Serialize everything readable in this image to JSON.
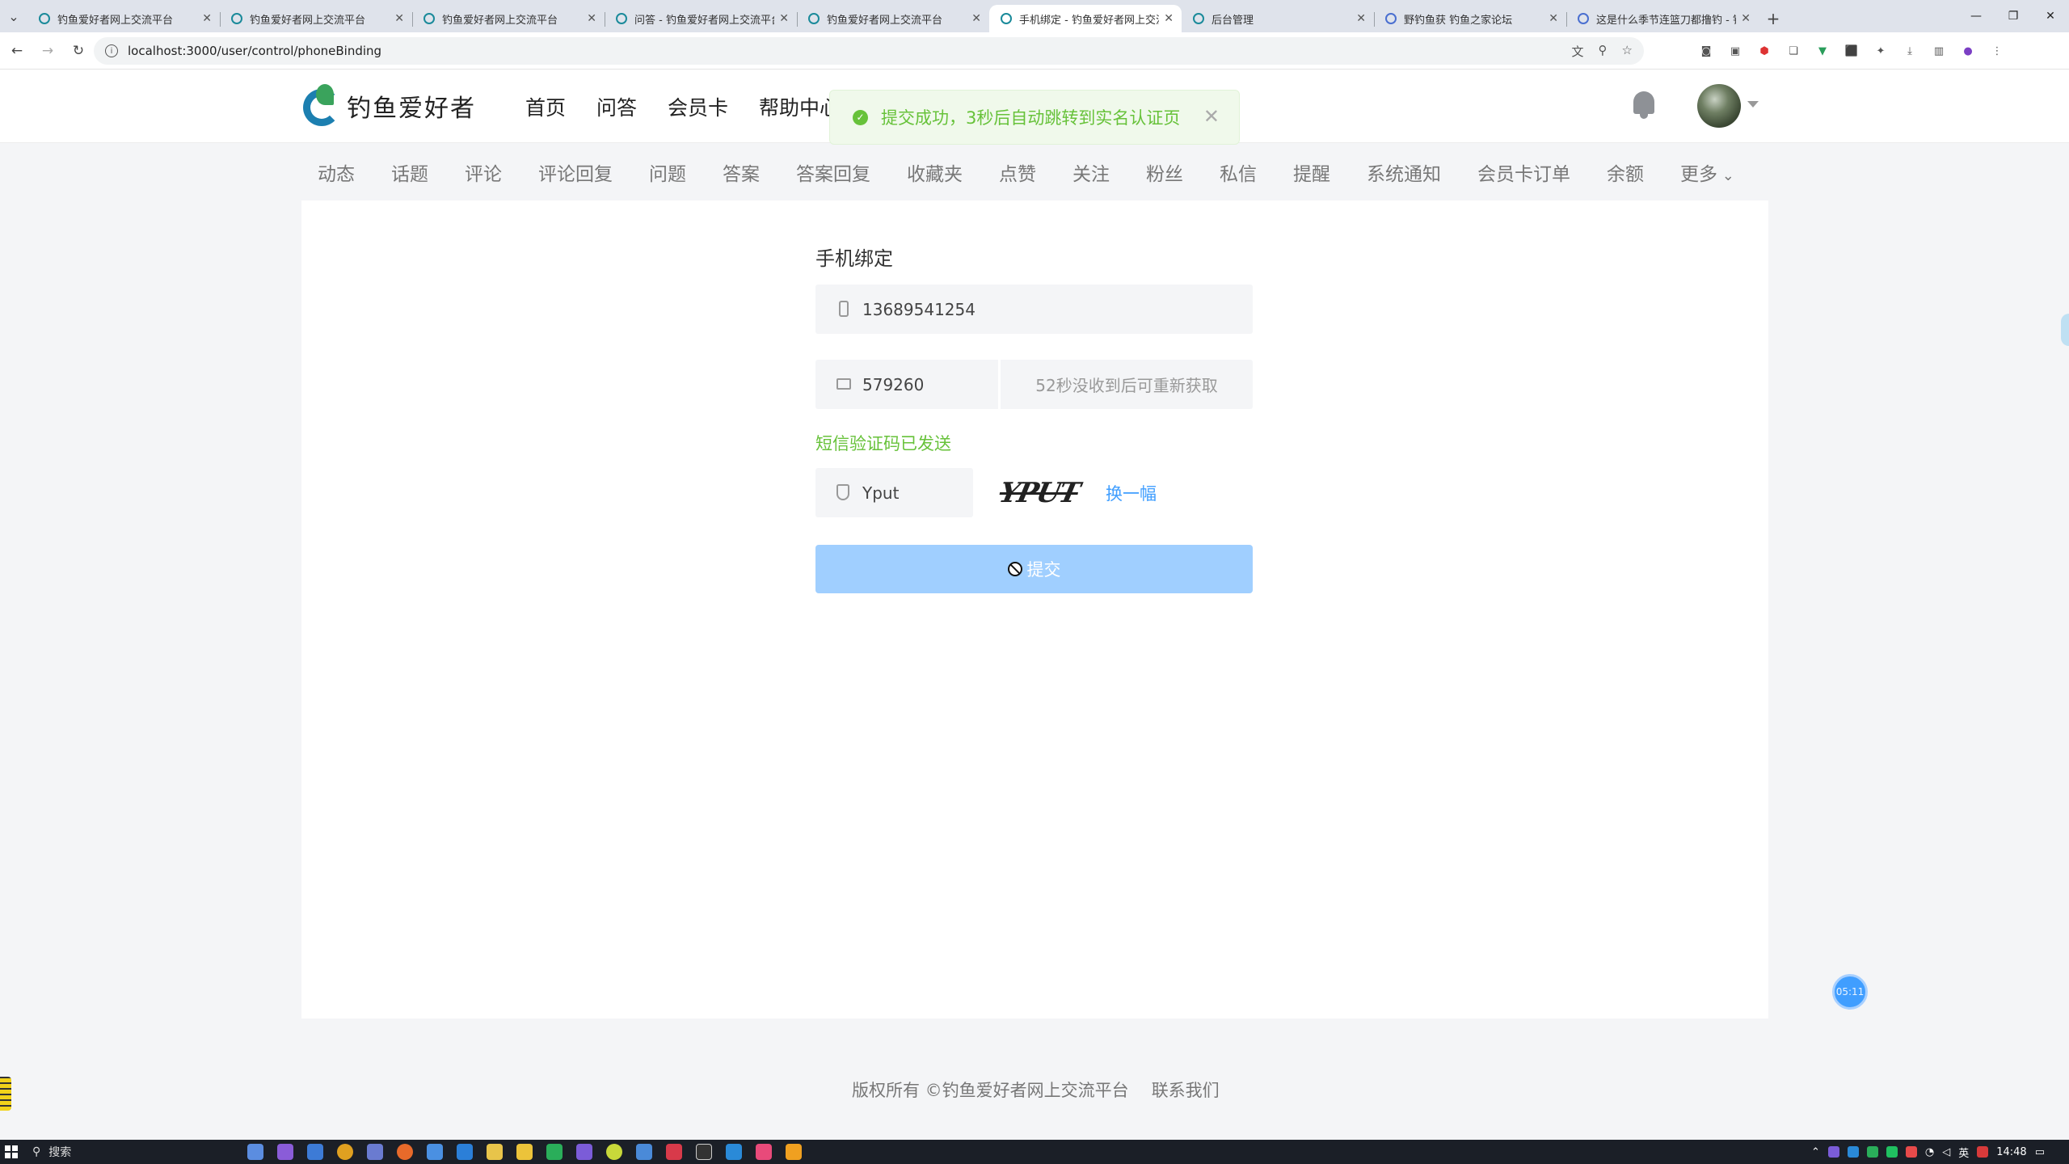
{
  "browser": {
    "tabs": [
      {
        "title": "钓鱼爱好者网上交流平台",
        "active": false,
        "favicon": "site-icon"
      },
      {
        "title": "钓鱼爱好者网上交流平台",
        "active": false,
        "favicon": "site-icon"
      },
      {
        "title": "钓鱼爱好者网上交流平台",
        "active": false,
        "favicon": "site-icon"
      },
      {
        "title": "问答 - 钓鱼爱好者网上交流平台",
        "active": false,
        "favicon": "site-icon"
      },
      {
        "title": "钓鱼爱好者网上交流平台",
        "active": false,
        "favicon": "site-icon"
      },
      {
        "title": "手机绑定 - 钓鱼爱好者网上交流",
        "active": true,
        "favicon": "site-icon"
      },
      {
        "title": "后台管理",
        "active": false,
        "favicon": "site-icon"
      },
      {
        "title": "野钓鱼获 钓鱼之家论坛",
        "active": false,
        "favicon": "globe-icon"
      },
      {
        "title": "这是什么季节连篮刀都撸钓 - 钓",
        "active": false,
        "favicon": "globe-icon"
      }
    ],
    "url": "localhost:3000/user/control/phoneBinding"
  },
  "site": {
    "logo_text": "钓鱼爱好者",
    "nav": [
      "首页",
      "问答",
      "会员卡",
      "帮助中心"
    ]
  },
  "toast": {
    "message": "提交成功，3秒后自动跳转到实名认证页",
    "type": "success",
    "color": "#67c23a"
  },
  "subnav": [
    "动态",
    "话题",
    "评论",
    "评论回复",
    "问题",
    "答案",
    "答案回复",
    "收藏夹",
    "点赞",
    "关注",
    "粉丝",
    "私信",
    "提醒",
    "系统通知",
    "会员卡订单",
    "余额",
    "更多"
  ],
  "form": {
    "title": "手机绑定",
    "phone_value": "13689541254",
    "sms_code_value": "579260",
    "sms_button": "52秒没收到后可重新获取",
    "sms_status": "短信验证码已发送",
    "captcha_value": "Yput",
    "captcha_image_text": "YPUT",
    "captcha_refresh": "换一幅",
    "submit_label": "提交",
    "submit_color": "#a0cfff"
  },
  "timer_bubble": "05:11",
  "footer": {
    "copyright": "版权所有 ©钓鱼爱好者网上交流平台",
    "contact": "联系我们"
  },
  "taskbar": {
    "search_placeholder": "搜索",
    "ime": "英",
    "time": "14:48"
  }
}
